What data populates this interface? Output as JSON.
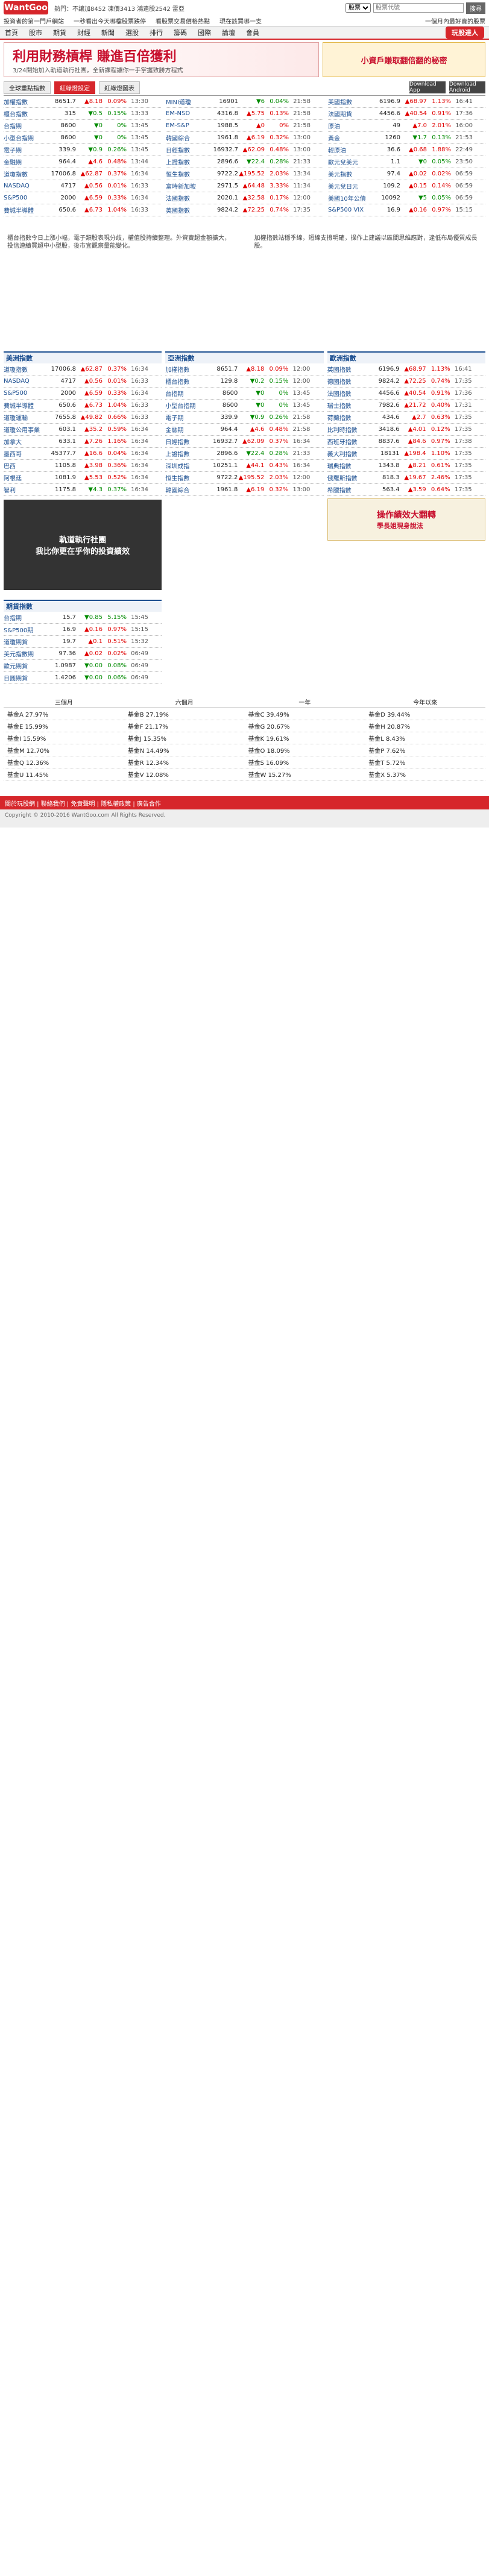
{
  "brand": {
    "logo": "WantGoo"
  },
  "topbar": {
    "hot": "熱門：不讓加8452 凍價3413 鴻遠股2542 雷亞",
    "search_placeholder": "股票代號",
    "search_label": "股票",
    "search_button": "搜尋"
  },
  "subbar": {
    "left": "投資者的第一門戶網站",
    "links": [
      "一秒看出今天哪檔股票跌停",
      "看股票交易價格熱點",
      "現在該買哪一支",
      "一個月內最好賣的股票"
    ]
  },
  "nav": {
    "items": [
      "首頁",
      "股市",
      "期貨",
      "財經",
      "新聞",
      "選股",
      "排行",
      "籌碼",
      "國際",
      "論壇",
      "會員"
    ],
    "play": "玩股達人"
  },
  "banner": {
    "title": "利用財務槓桿 賺進百倍獲利",
    "subtitle": "3/24開始加入軌道執行社團，全新課程讓你一手掌握致勝方程式",
    "ad": "小資戶賺取翻倍翻的秘密"
  },
  "strip": {
    "tabs": [
      "全球重點指數",
      "紅綠燈設定",
      "紅綠燈圖表"
    ],
    "apps": [
      "Download App",
      "Download Android"
    ]
  },
  "ticker": {
    "col1": [
      {
        "n": "加權指數",
        "v": "8651.7",
        "c": "▲8.18",
        "p": "0.09%",
        "t": "13:30"
      },
      {
        "n": "櫃台指數",
        "v": "315",
        "c": "▼0.5",
        "p": "0.15%",
        "t": "13:33"
      },
      {
        "n": "台指期",
        "v": "8600",
        "c": "▼0",
        "p": "0%",
        "t": "13:45"
      },
      {
        "n": "小型台指期",
        "v": "8600",
        "c": "▼0",
        "p": "0%",
        "t": "13:45"
      },
      {
        "n": "電子期",
        "v": "339.9",
        "c": "▼0.9",
        "p": "0.26%",
        "t": "13:45"
      },
      {
        "n": "金融期",
        "v": "964.4",
        "c": "▲4.6",
        "p": "0.48%",
        "t": "13:44"
      },
      {
        "n": "道瓊指數",
        "v": "17006.8",
        "c": "▲62.87",
        "p": "0.37%",
        "t": "16:34"
      },
      {
        "n": "NASDAQ",
        "v": "4717",
        "c": "▲0.56",
        "p": "0.01%",
        "t": "16:33"
      },
      {
        "n": "S&P500",
        "v": "2000",
        "c": "▲6.59",
        "p": "0.33%",
        "t": "16:34"
      },
      {
        "n": "費城半導體",
        "v": "650.6",
        "c": "▲6.73",
        "p": "1.04%",
        "t": "16:33"
      }
    ],
    "col2": [
      {
        "n": "MINI道瓊",
        "v": "16901",
        "c": "▼6",
        "p": "0.04%",
        "t": "21:58"
      },
      {
        "n": "EM-NSD",
        "v": "4316.8",
        "c": "▲5.75",
        "p": "0.13%",
        "t": "21:58"
      },
      {
        "n": "EM-S&P",
        "v": "1988.5",
        "c": "▲0",
        "p": "0%",
        "t": "21:58"
      },
      {
        "n": "韓國綜合",
        "v": "1961.8",
        "c": "▲6.19",
        "p": "0.32%",
        "t": "13:00"
      },
      {
        "n": "日經指數",
        "v": "16932.7",
        "c": "▲62.09",
        "p": "0.48%",
        "t": "13:00"
      },
      {
        "n": "上證指數",
        "v": "2896.6",
        "c": "▼22.4",
        "p": "0.28%",
        "t": "21:33"
      },
      {
        "n": "恒生指數",
        "v": "9722.2",
        "c": "▲195.52",
        "p": "2.03%",
        "t": "13:34"
      },
      {
        "n": "富時新加坡",
        "v": "2971.5",
        "c": "▲64.48",
        "p": "3.33%",
        "t": "11:34"
      },
      {
        "n": "法國指數",
        "v": "2020.1",
        "c": "▲32.58",
        "p": "0.17%",
        "t": "12:00"
      },
      {
        "n": "英國指數",
        "v": "9824.2",
        "c": "▲72.25",
        "p": "0.74%",
        "t": "17:35"
      }
    ],
    "col3": [
      {
        "n": "美國指數",
        "v": "6196.9",
        "c": "▲68.97",
        "p": "1.13%",
        "t": "16:41"
      },
      {
        "n": "法國期貨",
        "v": "4456.6",
        "c": "▲40.54",
        "p": "0.91%",
        "t": "17:36"
      },
      {
        "n": "原油",
        "v": "49",
        "c": "▲7.0",
        "p": "2.01%",
        "t": "16:00"
      },
      {
        "n": "黃金",
        "v": "1260",
        "c": "▼1.7",
        "p": "0.13%",
        "t": "21:53"
      },
      {
        "n": "輕原油",
        "v": "36.6",
        "c": "▲0.68",
        "p": "1.88%",
        "t": "22:49"
      },
      {
        "n": "歐元兌美元",
        "v": "1.1",
        "c": "▼0",
        "p": "0.05%",
        "t": "23:50"
      },
      {
        "n": "美元指數",
        "v": "97.4",
        "c": "▲0.02",
        "p": "0.02%",
        "t": "06:59"
      },
      {
        "n": "美元兌日元",
        "v": "109.2",
        "c": "▲0.15",
        "p": "0.14%",
        "t": "06:59"
      },
      {
        "n": "美國10年公債",
        "v": "10092",
        "c": "▼5",
        "p": "0.05%",
        "t": "06:59"
      },
      {
        "n": "S&P500 VIX",
        "v": "16.9",
        "c": "▲0.16",
        "p": "0.97%",
        "t": "15:15"
      }
    ]
  },
  "adtext": [
    "櫃台指數今日上漲小幅，電子類股表現分歧，權值股持續整理。外資賣超金額擴大，投信連續買超中小型股，後市宜觀察量能變化。",
    "加權指數站穩季線，短線支撐明確，操作上建議以區間思維應對，逢低布局優質成長股。"
  ],
  "sections": {
    "us": {
      "title": "美洲指數",
      "rows": [
        {
          "n": "道瓊指數",
          "v": "17006.8",
          "c": "▲62.87",
          "p": "0.37%",
          "t": "16:34"
        },
        {
          "n": "NASDAQ",
          "v": "4717",
          "c": "▲0.56",
          "p": "0.01%",
          "t": "16:33"
        },
        {
          "n": "S&P500",
          "v": "2000",
          "c": "▲6.59",
          "p": "0.33%",
          "t": "16:34"
        },
        {
          "n": "費城半導體",
          "v": "650.6",
          "c": "▲6.73",
          "p": "1.04%",
          "t": "16:33"
        },
        {
          "n": "道瓊運輸",
          "v": "7655.8",
          "c": "▲49.82",
          "p": "0.66%",
          "t": "16:33"
        },
        {
          "n": "道瓊公用事業",
          "v": "603.1",
          "c": "▲35.2",
          "p": "0.59%",
          "t": "16:34"
        },
        {
          "n": "加拿大",
          "v": "633.1",
          "c": "▲7.26",
          "p": "1.16%",
          "t": "16:34"
        },
        {
          "n": "墨西哥",
          "v": "45377.7",
          "c": "▲16.6",
          "p": "0.04%",
          "t": "16:34"
        },
        {
          "n": "巴西",
          "v": "1105.8",
          "c": "▲3.98",
          "p": "0.36%",
          "t": "16:34"
        },
        {
          "n": "阿根廷",
          "v": "1081.9",
          "c": "▲5.53",
          "p": "0.52%",
          "t": "16:34"
        },
        {
          "n": "智利",
          "v": "1175.8",
          "c": "▼4.3",
          "p": "0.37%",
          "t": "16:34"
        }
      ]
    },
    "asia": {
      "title": "亞洲指數",
      "rows": [
        {
          "n": "加權指數",
          "v": "8651.7",
          "c": "▲8.18",
          "p": "0.09%",
          "t": "12:00"
        },
        {
          "n": "櫃台指數",
          "v": "129.8",
          "c": "▼0.2",
          "p": "0.15%",
          "t": "12:00"
        },
        {
          "n": "台指期",
          "v": "8600",
          "c": "▼0",
          "p": "0%",
          "t": "13:45"
        },
        {
          "n": "小型台指期",
          "v": "8600",
          "c": "▼0",
          "p": "0%",
          "t": "13:45"
        },
        {
          "n": "電子期",
          "v": "339.9",
          "c": "▼0.9",
          "p": "0.26%",
          "t": "21:58"
        },
        {
          "n": "金融期",
          "v": "964.4",
          "c": "▲4.6",
          "p": "0.48%",
          "t": "21:58"
        },
        {
          "n": "日經指數",
          "v": "16932.7",
          "c": "▲62.09",
          "p": "0.37%",
          "t": "16:34"
        },
        {
          "n": "上證指數",
          "v": "2896.6",
          "c": "▼22.4",
          "p": "0.28%",
          "t": "21:33"
        },
        {
          "n": "深圳成指",
          "v": "10251.1",
          "c": "▲44.1",
          "p": "0.43%",
          "t": "16:34"
        },
        {
          "n": "恒生指數",
          "v": "9722.2",
          "c": "▲195.52",
          "p": "2.03%",
          "t": "12:00"
        },
        {
          "n": "韓國綜合",
          "v": "1961.8",
          "c": "▲6.19",
          "p": "0.32%",
          "t": "13:00"
        }
      ]
    },
    "eu": {
      "title": "歐洲指數",
      "rows": [
        {
          "n": "英國指數",
          "v": "6196.9",
          "c": "▲68.97",
          "p": "1.13%",
          "t": "16:41"
        },
        {
          "n": "德國指數",
          "v": "9824.2",
          "c": "▲72.25",
          "p": "0.74%",
          "t": "17:35"
        },
        {
          "n": "法國指數",
          "v": "4456.6",
          "c": "▲40.54",
          "p": "0.91%",
          "t": "17:36"
        },
        {
          "n": "瑞士指數",
          "v": "7982.6",
          "c": "▲21.72",
          "p": "0.40%",
          "t": "17:31"
        },
        {
          "n": "荷蘭指數",
          "v": "434.6",
          "c": "▲2.7",
          "p": "0.63%",
          "t": "17:35"
        },
        {
          "n": "比利時指數",
          "v": "3418.6",
          "c": "▲4.01",
          "p": "0.12%",
          "t": "17:35"
        },
        {
          "n": "西班牙指數",
          "v": "8837.6",
          "c": "▲84.6",
          "p": "0.97%",
          "t": "17:38"
        },
        {
          "n": "義大利指數",
          "v": "18131",
          "c": "▲198.4",
          "p": "1.10%",
          "t": "17:35"
        },
        {
          "n": "瑞典指數",
          "v": "1343.8",
          "c": "▲8.21",
          "p": "0.61%",
          "t": "17:35"
        },
        {
          "n": "俄羅斯指數",
          "v": "818.3",
          "c": "▲19.67",
          "p": "2.46%",
          "t": "17:35"
        },
        {
          "n": "希臘指數",
          "v": "563.4",
          "c": "▲3.59",
          "p": "0.64%",
          "t": "17:35"
        }
      ]
    }
  },
  "promo": {
    "left": "我比你更在乎你的投資績效",
    "left_sub": "軌道執行社團",
    "right_title": "操作績效大翻轉",
    "right_sub": "學長姐現身說法"
  },
  "futures": {
    "title": "期貨指數",
    "rows": [
      {
        "n": "台指期",
        "v": "15.7",
        "c": "▼0.85",
        "p": "5.15%",
        "t": "15:45"
      },
      {
        "n": "S&P500期",
        "v": "16.9",
        "c": "▲0.16",
        "p": "0.97%",
        "t": "15:15"
      },
      {
        "n": "道瓊期貨",
        "v": "19.7",
        "c": "▲0.1",
        "p": "0.51%",
        "t": "15:32"
      },
      {
        "n": "美元指數期",
        "v": "97.36",
        "c": "▲0.02",
        "p": "0.02%",
        "t": "06:49"
      },
      {
        "n": "歐元期貨",
        "v": "1.0987",
        "c": "▼0.00",
        "p": "0.08%",
        "t": "06:49"
      },
      {
        "n": "日圓期貨",
        "v": "1.4206",
        "c": "▼0.00",
        "p": "0.06%",
        "t": "06:49"
      }
    ]
  },
  "ranking": {
    "head": [
      "三個月",
      "六個月",
      "一年",
      "今年以來"
    ],
    "rows": [
      [
        "基金A 27.97%",
        "基金B 27.19%",
        "基金C 39.49%",
        "基金D 39.44%"
      ],
      [
        "基金E 15.99%",
        "基金F 21.17%",
        "基金G 20.67%",
        "基金H 20.87%"
      ],
      [
        "基金I 15.59%",
        "基金J 15.35%",
        "基金K 19.61%",
        "基金L 8.43%"
      ],
      [
        "基金M 12.70%",
        "基金N 14.49%",
        "基金O 18.09%",
        "基金P 7.62%"
      ],
      [
        "基金Q 12.36%",
        "基金R 12.34%",
        "基金S 16.09%",
        "基金T 5.72%"
      ],
      [
        "基金U 11.45%",
        "基金V 12.08%",
        "基金W 15.27%",
        "基金X 5.37%"
      ]
    ]
  },
  "footer": {
    "links": "關於玩股網 | 聯絡我們 | 免責聲明 | 隱私權政策 | 廣告合作",
    "copyright": "Copyright © 2010-2016 WantGoo.com All Rights Reserved."
  }
}
